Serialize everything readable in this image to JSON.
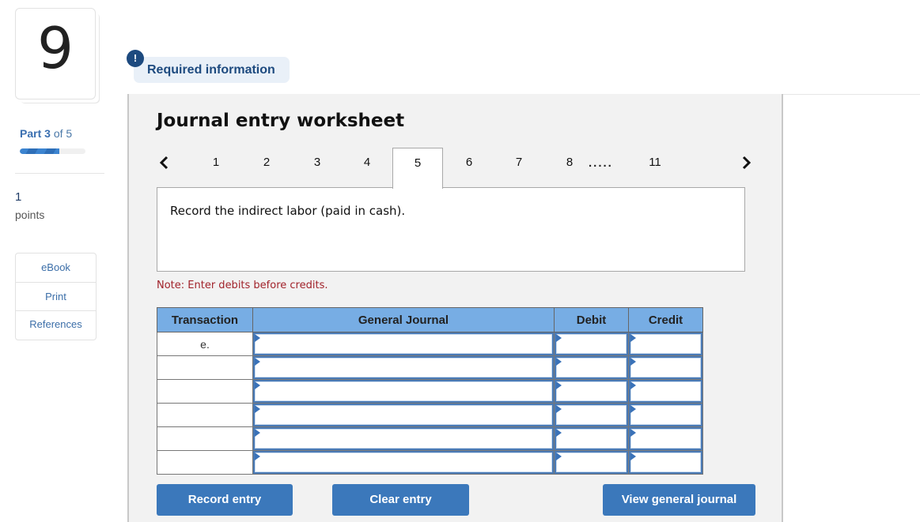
{
  "question": {
    "number": "9",
    "part_prefix": "Part",
    "part_current": "3",
    "part_suffix": "of 5",
    "progress_fraction": 0.6,
    "points_value": "1",
    "points_label": "points"
  },
  "tools": [
    {
      "label": "eBook"
    },
    {
      "label": "Print"
    },
    {
      "label": "References"
    }
  ],
  "required_info": {
    "badge": "!",
    "label": "Required information"
  },
  "worksheet": {
    "title": "Journal entry worksheet",
    "pages": [
      "1",
      "2",
      "3",
      "4",
      "5",
      "6",
      "7",
      "8",
      "11"
    ],
    "active_page": "5",
    "ellipsis": ".....",
    "prompt": "Record the indirect labor (paid in cash).",
    "note": "Note: Enter debits before credits."
  },
  "table": {
    "headers": {
      "transaction": "Transaction",
      "general_journal": "General Journal",
      "debit": "Debit",
      "credit": "Credit"
    },
    "rows": [
      {
        "transaction": "e.",
        "account": "",
        "debit": "",
        "credit": ""
      },
      {
        "transaction": "",
        "account": "",
        "debit": "",
        "credit": ""
      },
      {
        "transaction": "",
        "account": "",
        "debit": "",
        "credit": ""
      },
      {
        "transaction": "",
        "account": "",
        "debit": "",
        "credit": ""
      },
      {
        "transaction": "",
        "account": "",
        "debit": "",
        "credit": ""
      },
      {
        "transaction": "",
        "account": "",
        "debit": "",
        "credit": ""
      }
    ]
  },
  "buttons": {
    "record": "Record entry",
    "clear": "Clear entry",
    "view": "View general journal"
  },
  "colors": {
    "accent_blue": "#3b78bb",
    "header_blue": "#77ade4",
    "note_red": "#a1232b",
    "badge_navy": "#1d4a7f"
  }
}
